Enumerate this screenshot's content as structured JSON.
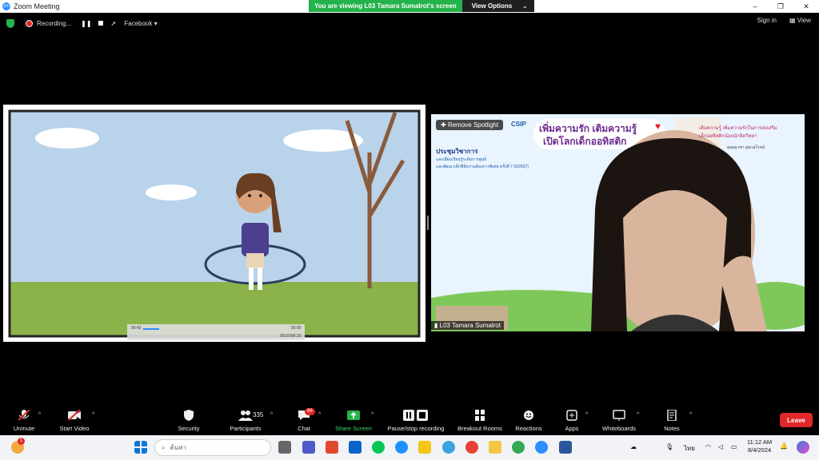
{
  "window": {
    "title": "Zoom Meeting",
    "controls": [
      "–",
      "❐",
      "✕"
    ]
  },
  "banner": {
    "message": "You are viewing L03 Tamara Sumalrot's screen",
    "options_label": "View Options"
  },
  "topbar": {
    "recording_label": "Recording...",
    "facebook_label": "Facebook",
    "sign_in": "Sign in",
    "view": "View"
  },
  "left_video": {
    "player": {
      "time_current": "06:42",
      "time_total": "05:00",
      "duration": "00:07/00:10"
    }
  },
  "right_video": {
    "remove_spotlight": "Remove Spotlight",
    "participant_name": "L03 Tamara Sumalrot",
    "slide": {
      "logo_text": "CSIP",
      "title_line1": "เพิ่มความรัก เติมความรู้",
      "title_line2": "เปิดโลกเด็กออทิสติก",
      "heading": "ประชุมวิชาการ",
      "sub1": "และเยี่ยมเรียนรู้ระดับการศูนย์",
      "sub2": "และพัฒนาเด็กที่มีความต้องการพิเศษ ครั้งที่ 7 (6/2567)",
      "right_text1": "เติมความรู้ เพิ่มความรักในการส่งเสริม",
      "right_text2": "เด็กออทิสติกน้อยนักจิตวิทยา",
      "speaker": "คุณณาชา สุนาลโรจน์"
    }
  },
  "toolbar": {
    "unmute": "Unmute",
    "start_video": "Start Video",
    "security": "Security",
    "participants": "Participants",
    "participants_count": "335",
    "chat": "Chat",
    "chat_badge": "66",
    "share_screen": "Share Screen",
    "pause_recording": "Pause/stop recording",
    "breakout": "Breakout Rooms",
    "reactions": "Reactions",
    "apps": "Apps",
    "whiteboards": "Whiteboards",
    "notes": "Notes",
    "leave": "Leave"
  },
  "taskbar": {
    "search_placeholder": "ค้นหา",
    "lang": "ไทย",
    "time": "11:12 AM",
    "date": "8/4/2024",
    "notif_badge": "1"
  },
  "colors": {
    "accent": "#2d8cff",
    "green": "#24b24a",
    "red": "#e02828"
  }
}
